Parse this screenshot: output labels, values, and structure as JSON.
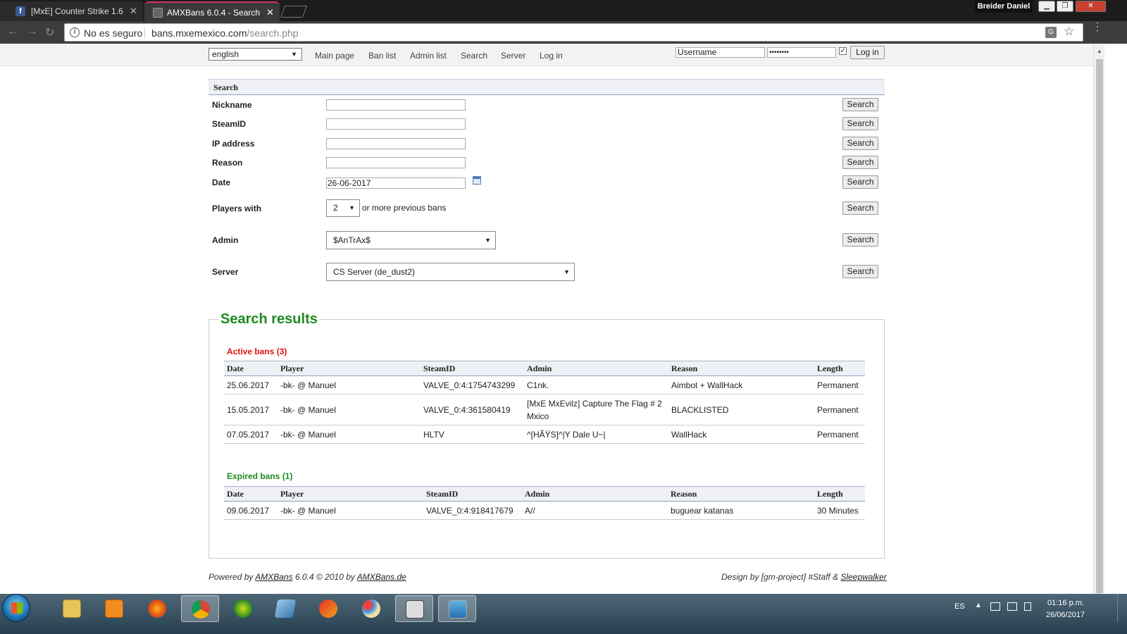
{
  "browser": {
    "tabs": [
      {
        "title": "[MxE] Counter Strike 1.6",
        "favicon": "facebook-icon"
      },
      {
        "title": "AMXBans 6.0.4 - Search",
        "favicon": "page-icon"
      }
    ],
    "profile_name": "Breider Daniel",
    "security_label": "No es seguro",
    "url_host": "bans.mxemexico.com",
    "url_path": "/search.php"
  },
  "nav": {
    "language": "english",
    "links": [
      "Main page",
      "Ban list",
      "Admin list",
      "Search",
      "Server",
      "Log in"
    ],
    "username_value": "Username",
    "password_value": "••••••••",
    "login_button": "Log in"
  },
  "search": {
    "heading": "Search",
    "fields": {
      "nickname": {
        "label": "Nickname",
        "value": ""
      },
      "steamid": {
        "label": "SteamID",
        "value": ""
      },
      "ip": {
        "label": "IP address",
        "value": ""
      },
      "reason": {
        "label": "Reason",
        "value": ""
      },
      "date": {
        "label": "Date",
        "value": "26-06-2017"
      },
      "players": {
        "label": "Players with",
        "value": "2",
        "suffix": "or more previous bans"
      },
      "admin": {
        "label": "Admin",
        "value": "$AnTrAx$"
      },
      "server": {
        "label": "Server",
        "value": "CS Server (de_dust2)"
      }
    },
    "button_label": "Search"
  },
  "results": {
    "title": "Search results",
    "active_title": "Active bans (3)",
    "expired_title": "Expired bans (1)",
    "columns": [
      "Date",
      "Player",
      "SteamID",
      "Admin",
      "Reason",
      "Length"
    ],
    "active": [
      [
        "25.06.2017",
        "-bk- @ Manuel",
        "VALVE_0:4:1754743299",
        "C1nk.",
        "Aimbot + WallHack",
        "Permanent"
      ],
      [
        "15.05.2017",
        "-bk- @ Manuel",
        "VALVE_0:4:361580419",
        "[MxE MxEvilz] Capture The Flag # 2 Mxico",
        "BLACKLISTED",
        "Permanent"
      ],
      [
        "07.05.2017",
        "-bk- @ Manuel",
        "HLTV",
        "^[HÃŸS]^|Y Dale U~|",
        "WallHack",
        "Permanent"
      ]
    ],
    "expired": [
      [
        "09.06.2017",
        "-bk- @ Manuel",
        "VALVE_0:4:918417679",
        "A//",
        "buguear katanas",
        "30 Minutes"
      ]
    ]
  },
  "footer": {
    "powered_prefix": "Powered by",
    "amxbans_link": "AMXBans",
    "powered_middle": "6.0.4 © 2010 by",
    "amxbans_de_link": "AMXBans.de",
    "design_prefix": "Design by [gm-project] #Staff &",
    "sleepwalker_link": "Sleepwalker"
  },
  "taskbar": {
    "apps": [
      "file-explorer-icon",
      "media-player-icon",
      "firefox-icon",
      "chrome-icon",
      "app-icon",
      "notepad-icon",
      "ccleaner-icon",
      "paint-icon",
      "counter-strike-icon",
      "photo-viewer-icon"
    ],
    "language": "ES",
    "time": "01:16 p.m.",
    "date": "26/06/2017"
  },
  "colors": {
    "active_red": "#e01010",
    "expired_green": "#1d8a1d",
    "tab_accent": "#d0336d"
  }
}
